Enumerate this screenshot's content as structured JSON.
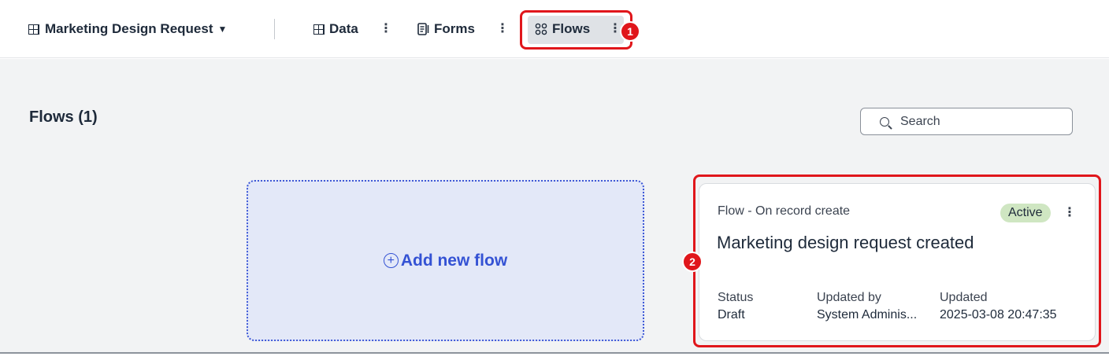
{
  "header": {
    "app_title": "Marketing Design Request",
    "tabs": [
      {
        "label": "Data",
        "icon": "table-icon"
      },
      {
        "label": "Forms",
        "icon": "form-icon"
      },
      {
        "label": "Flows",
        "icon": "flow-icon",
        "selected": true
      }
    ],
    "kebab": "⋮"
  },
  "callouts": [
    "1",
    "2"
  ],
  "page": {
    "heading": "Flows (1)",
    "search_placeholder": "Search"
  },
  "add_card": {
    "label": "Add new flow",
    "plus": "+"
  },
  "flow_card": {
    "type": "Flow - On record create",
    "status_badge": "Active",
    "name": "Marketing design request created",
    "columns": [
      {
        "label": "Status",
        "value": "Draft"
      },
      {
        "label": "Updated by",
        "value": "System Adminis..."
      },
      {
        "label": "Updated",
        "value": "2025-03-08 20:47:35"
      }
    ]
  },
  "colors": {
    "highlight": "#e0161b",
    "accent": "#3452d4",
    "active_badge": "#cfe6c2"
  }
}
